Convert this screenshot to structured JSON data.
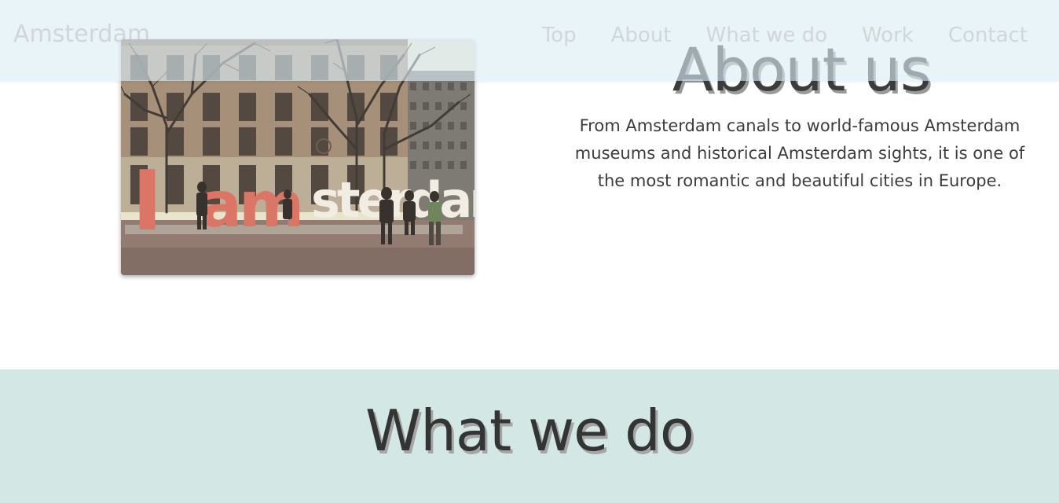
{
  "navbar": {
    "brand": "Amsterdam",
    "links": [
      "Top",
      "About",
      "What we do",
      "Work",
      "Contact"
    ]
  },
  "about": {
    "title": "About us",
    "text": "From Amsterdam canals to world-famous Amsterdam museums and historical Amsterdam sights, it is one of the most romantic and beautiful cities in Europe.",
    "photo": {
      "sign_text": "Iamsterdam",
      "sign_red_part": "I am",
      "sign_white_part": "sterdam"
    }
  },
  "what_we_do": {
    "title": "What we do"
  },
  "colors": {
    "nav_background": "#dceef6",
    "section_teal": "#d3e8e5",
    "heading": "#3a3d3e",
    "sign_red": "#d9685c"
  }
}
